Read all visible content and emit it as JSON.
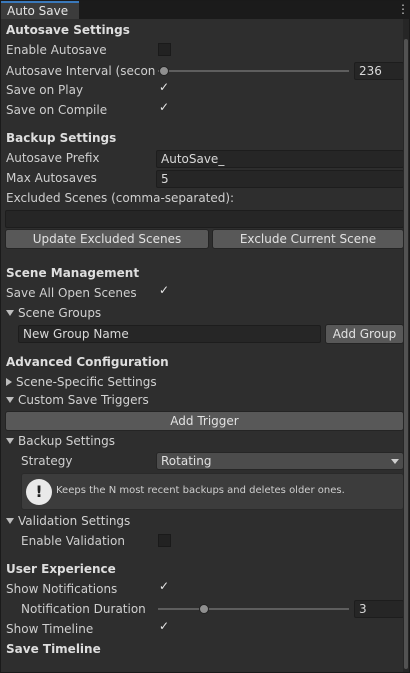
{
  "window": {
    "tab_title": "Auto Save",
    "menu_icon": "kebab-icon"
  },
  "autosave": {
    "header": "Autosave Settings",
    "enable_label": "Enable Autosave",
    "enable_checked": false,
    "interval_label": "Autosave Interval (seconds",
    "interval_value": "236",
    "interval_fraction": 0.03,
    "save_on_play_label": "Save on Play",
    "save_on_play_checked": true,
    "save_on_compile_label": "Save on Compile",
    "save_on_compile_checked": true
  },
  "backup": {
    "header": "Backup Settings",
    "prefix_label": "Autosave Prefix",
    "prefix_value": "AutoSave_",
    "max_label": "Max Autosaves",
    "max_value": "5",
    "excluded_label": "Excluded Scenes (comma-separated):",
    "excluded_value": "",
    "update_button": "Update Excluded Scenes",
    "exclude_current_button": "Exclude Current Scene"
  },
  "scene_mgmt": {
    "header": "Scene Management",
    "save_all_label": "Save All Open Scenes",
    "save_all_checked": true,
    "groups_label": "Scene Groups",
    "group_name_value": "New Group Name",
    "add_group_button": "Add Group"
  },
  "advanced": {
    "header": "Advanced Configuration",
    "scene_specific_label": "Scene-Specific Settings",
    "custom_triggers_label": "Custom Save Triggers",
    "add_trigger_button": "Add Trigger",
    "backup_settings_label": "Backup Settings",
    "strategy_label": "Strategy",
    "strategy_value": "Rotating",
    "help_text": "Keeps the N most recent backups and deletes older ones.",
    "help_icon": "exclamation-icon",
    "validation_label": "Validation Settings",
    "enable_validation_label": "Enable Validation",
    "enable_validation_checked": false
  },
  "ux": {
    "header": "User Experience",
    "notifications_label": "Show Notifications",
    "notifications_checked": true,
    "duration_label": "Notification Duration",
    "duration_value": "3",
    "duration_fraction": 0.24,
    "timeline_label": "Show Timeline",
    "timeline_checked": true,
    "save_timeline_header": "Save Timeline"
  }
}
